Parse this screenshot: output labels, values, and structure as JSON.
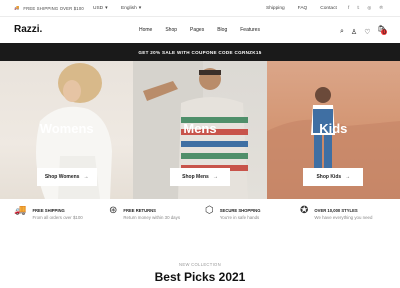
{
  "topbar": {
    "shipping_text": "FREE SHIPPING OVER $100",
    "currency": "USD",
    "language": "English",
    "links": [
      "Shipping",
      "FAQ",
      "Contact"
    ],
    "social": [
      "f",
      "t",
      "ig",
      "p"
    ]
  },
  "header": {
    "logo": "Razzi.",
    "nav": [
      "Home",
      "Shop",
      "Pages",
      "Blog",
      "Features"
    ],
    "cart_count": "0"
  },
  "promo": {
    "text": "GET 20% SALE WITH COUPONE CODE CGRNZK15"
  },
  "banners": [
    {
      "title": "Womens",
      "button": "Shop Womens"
    },
    {
      "title": "Mens",
      "button": "Shop Mens"
    },
    {
      "title": "Kids",
      "button": "Shop Kids"
    }
  ],
  "features": [
    {
      "title": "FREE SHIPPING",
      "desc": "From all orders over $100"
    },
    {
      "title": "FREE RETURNS",
      "desc": "Return money within 30 days"
    },
    {
      "title": "SECURE SHOPPING",
      "desc": "You're in safe hands"
    },
    {
      "title": "OVER 10,000 STYLES",
      "desc": "We have everything you need"
    }
  ],
  "section": {
    "subtitle": "NEW COLLECTION",
    "title": "Best Picks 2021"
  }
}
